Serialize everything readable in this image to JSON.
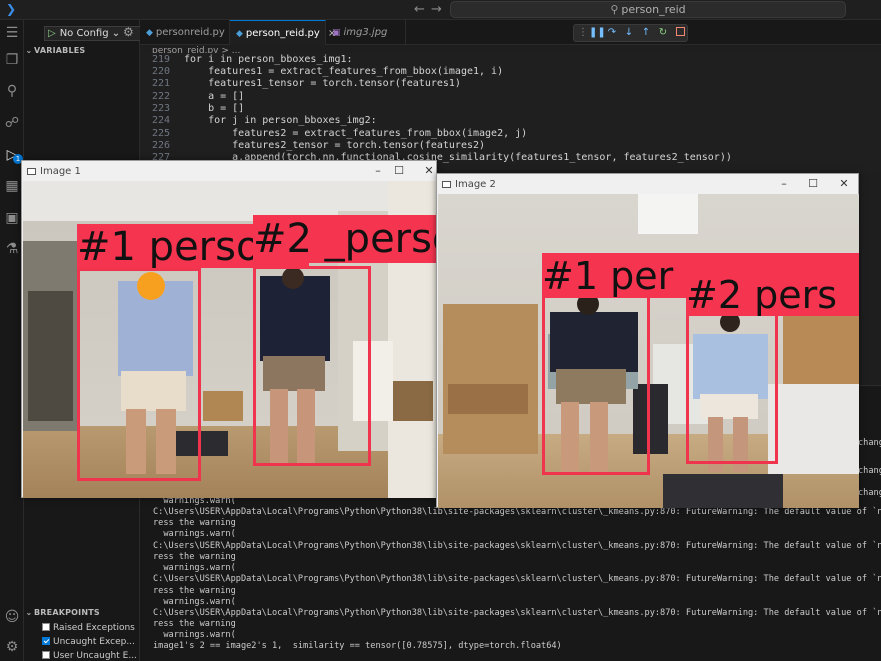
{
  "window": {
    "search": "person_reid"
  },
  "sidebar": {
    "run_config": "No Config",
    "variables_header": "VARIABLES",
    "breakpoints_header": "BREAKPOINTS",
    "breakpoints": [
      {
        "label": "Raised Exceptions",
        "checked": false
      },
      {
        "label": "Uncaught Excep...",
        "checked": true
      },
      {
        "label": "User Uncaught E...",
        "checked": false
      }
    ],
    "debug_badge": "1"
  },
  "tabs": [
    {
      "label": "personreid.py",
      "active": false
    },
    {
      "label": "person_reid.py",
      "active": true
    },
    {
      "label": "img3.jpg",
      "active": false
    }
  ],
  "breadcrumb": "person_reid.py > ...",
  "code": [
    {
      "num": "219",
      "text": "for i in person_bboxes_img1:"
    },
    {
      "num": "220",
      "text": "    features1 = extract_features_from_bbox(image1, i)"
    },
    {
      "num": "221",
      "text": "    features1_tensor = torch.tensor(features1)"
    },
    {
      "num": "222",
      "text": "    a = []"
    },
    {
      "num": "223",
      "text": "    b = []"
    },
    {
      "num": "224",
      "text": "    for j in person_bboxes_img2:"
    },
    {
      "num": "225",
      "text": "        features2 = extract_features_from_bbox(image2, j)"
    },
    {
      "num": "226",
      "text": "        features2_tensor = torch.tensor(features2)"
    },
    {
      "num": "227",
      "text": "        a.append(torch.nn.functional.cosine_similarity(features1_tensor, features2_tensor))"
    }
  ],
  "terminal": {
    "right_edge": [
      "changes",
      "chang",
      "change"
    ],
    "lines": [
      "  warnings.warn(",
      "C:\\Users\\USER\\AppData\\Local\\Programs\\Python\\Python38\\lib\\site-packages\\sklearn\\cluster\\_kmeans.py:870: FutureWarning: The default value of `n_init` will chang",
      "ress the warning",
      "  warnings.warn(",
      "C:\\Users\\USER\\AppData\\Local\\Programs\\Python\\Python38\\lib\\site-packages\\sklearn\\cluster\\_kmeans.py:870: FutureWarning: The default value of `n_init` will chang",
      "ress the warning",
      "  warnings.warn(",
      "C:\\Users\\USER\\AppData\\Local\\Programs\\Python\\Python38\\lib\\site-packages\\sklearn\\cluster\\_kmeans.py:870: FutureWarning: The default value of `n_init` will chang",
      "ress the warning",
      "  warnings.warn(",
      "C:\\Users\\USER\\AppData\\Local\\Programs\\Python\\Python38\\lib\\site-packages\\sklearn\\cluster\\_kmeans.py:870: FutureWarning: The default value of `n_init` will chang",
      "ress the warning",
      "  warnings.warn(",
      "image1's 2 == image2's 1,  similarity == tensor([0.78575], dtype=torch.float64)"
    ]
  },
  "image1": {
    "title": "Image 1",
    "labels": [
      "#1 perso",
      "#2 perso",
      "#2 _perso"
    ]
  },
  "image2": {
    "title": "Image 2",
    "labels": [
      "#1 per",
      "#2 pers"
    ]
  },
  "colors": {
    "accent": "#0078d4",
    "bbox": "#f0344e"
  }
}
